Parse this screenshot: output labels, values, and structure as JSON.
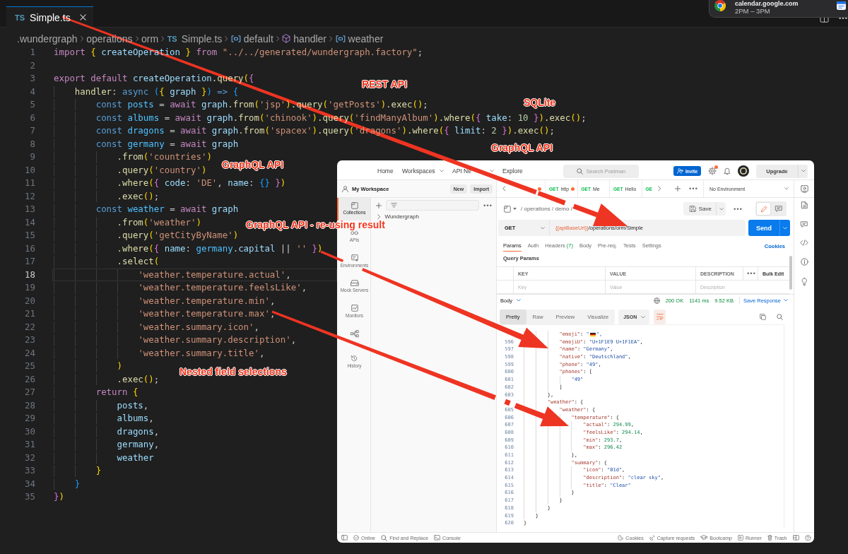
{
  "notification": {
    "title": "calendar.google.com",
    "subtitle": "2PM – 3PM"
  },
  "editor": {
    "tabs": [
      {
        "file_type": "TS",
        "label": "Simple.ts",
        "selected": true
      }
    ],
    "breadcrumb": [
      {
        "kind": "folder",
        "label": ".wundergraph"
      },
      {
        "kind": "folder",
        "label": "operations"
      },
      {
        "kind": "folder",
        "label": "orm"
      },
      {
        "kind": "file",
        "file_type": "TS",
        "label": "Simple.ts"
      },
      {
        "kind": "variable",
        "label": "default"
      },
      {
        "kind": "method",
        "label": "handler"
      },
      {
        "kind": "variable",
        "label": "weather"
      }
    ],
    "lines": [
      {
        "number": "1",
        "current": false,
        "tokens": [
          {
            "text": "import ",
            "kind": "kw"
          },
          {
            "text": "{",
            "kind": "br1"
          },
          {
            "text": " createOperation ",
            "kind": "var"
          },
          {
            "text": "}",
            "kind": "br1"
          },
          {
            "text": " from ",
            "kind": "kw"
          },
          {
            "text": "\"../../generated/wundergraph.factory\"",
            "kind": "str"
          },
          {
            "text": ";",
            "kind": "punct"
          }
        ]
      },
      {
        "number": "2",
        "current": false
      },
      {
        "number": "3",
        "current": false,
        "tokens": [
          {
            "text": "export default ",
            "kind": "kw"
          },
          {
            "text": "createOperation",
            "kind": "var"
          },
          {
            "text": ".query",
            "kind": "func"
          },
          {
            "text": "(",
            "kind": "br1"
          },
          {
            "text": "{",
            "kind": "br2"
          }
        ]
      },
      {
        "number": "4",
        "current": false,
        "tokens": [
          {
            "text": "    handler",
            "kind": "func"
          },
          {
            "text": ": ",
            "kind": "punct"
          },
          {
            "text": "async ",
            "kind": "storage"
          },
          {
            "text": "(",
            "kind": "br3"
          },
          {
            "text": "{",
            "kind": "br1"
          },
          {
            "text": " graph ",
            "kind": "var"
          },
          {
            "text": "}",
            "kind": "br1"
          },
          {
            "text": ")",
            "kind": "br3"
          },
          {
            "text": " => ",
            "kind": "storage"
          },
          {
            "text": "{",
            "kind": "br3"
          }
        ]
      },
      {
        "number": "5",
        "current": false,
        "tokens": [
          {
            "text": "        const ",
            "kind": "storage"
          },
          {
            "text": "posts",
            "kind": "const"
          },
          {
            "text": " = ",
            "kind": "punct"
          },
          {
            "text": "await ",
            "kind": "kw"
          },
          {
            "text": "graph",
            "kind": "var"
          },
          {
            "text": ".from",
            "kind": "func"
          },
          {
            "text": "(",
            "kind": "br1"
          },
          {
            "text": "'jsp'",
            "kind": "str"
          },
          {
            "text": ")",
            "kind": "br1"
          },
          {
            "text": ".query",
            "kind": "func"
          },
          {
            "text": "(",
            "kind": "br1"
          },
          {
            "text": "'getPosts'",
            "kind": "str"
          },
          {
            "text": ")",
            "kind": "br1"
          },
          {
            "text": ".exec",
            "kind": "func"
          },
          {
            "text": "()",
            "kind": "br1"
          },
          {
            "text": ";",
            "kind": "punct"
          }
        ]
      },
      {
        "number": "6",
        "current": false,
        "tokens": [
          {
            "text": "        const ",
            "kind": "storage"
          },
          {
            "text": "albums",
            "kind": "const"
          },
          {
            "text": " = ",
            "kind": "punct"
          },
          {
            "text": "await ",
            "kind": "kw"
          },
          {
            "text": "graph",
            "kind": "var"
          },
          {
            "text": ".from",
            "kind": "func"
          },
          {
            "text": "(",
            "kind": "br1"
          },
          {
            "text": "'chinook'",
            "kind": "str"
          },
          {
            "text": ")",
            "kind": "br1"
          },
          {
            "text": ".query",
            "kind": "func"
          },
          {
            "text": "(",
            "kind": "br1"
          },
          {
            "text": "'findManyAlbum'",
            "kind": "str"
          },
          {
            "text": ")",
            "kind": "br1"
          },
          {
            "text": ".where",
            "kind": "func"
          },
          {
            "text": "(",
            "kind": "br1"
          },
          {
            "text": "{",
            "kind": "br2"
          },
          {
            "text": " take",
            "kind": "var"
          },
          {
            "text": ": ",
            "kind": "punct"
          },
          {
            "text": "10",
            "kind": "num"
          },
          {
            "text": " }",
            "kind": "br2"
          },
          {
            "text": ")",
            "kind": "br1"
          },
          {
            "text": ".exec",
            "kind": "func"
          },
          {
            "text": "()",
            "kind": "br1"
          },
          {
            "text": ";",
            "kind": "punct"
          }
        ]
      },
      {
        "number": "7",
        "current": false,
        "tokens": [
          {
            "text": "        const ",
            "kind": "storage"
          },
          {
            "text": "dragons",
            "kind": "const"
          },
          {
            "text": " = ",
            "kind": "punct"
          },
          {
            "text": "await ",
            "kind": "kw"
          },
          {
            "text": "graph",
            "kind": "var"
          },
          {
            "text": ".from",
            "kind": "func"
          },
          {
            "text": "(",
            "kind": "br1"
          },
          {
            "text": "'spacex'",
            "kind": "str"
          },
          {
            "text": ")",
            "kind": "br1"
          },
          {
            "text": ".query",
            "kind": "func"
          },
          {
            "text": "(",
            "kind": "br1"
          },
          {
            "text": "'dragons'",
            "kind": "str"
          },
          {
            "text": ")",
            "kind": "br1"
          },
          {
            "text": ".where",
            "kind": "func"
          },
          {
            "text": "(",
            "kind": "br1"
          },
          {
            "text": "{",
            "kind": "br2"
          },
          {
            "text": " limit",
            "kind": "var"
          },
          {
            "text": ": ",
            "kind": "punct"
          },
          {
            "text": "2",
            "kind": "num"
          },
          {
            "text": " }",
            "kind": "br2"
          },
          {
            "text": ")",
            "kind": "br1"
          },
          {
            "text": ".exec",
            "kind": "func"
          },
          {
            "text": "()",
            "kind": "br1"
          },
          {
            "text": ";",
            "kind": "punct"
          }
        ]
      },
      {
        "number": "8",
        "current": false,
        "tokens": [
          {
            "text": "        const ",
            "kind": "storage"
          },
          {
            "text": "germany",
            "kind": "const"
          },
          {
            "text": " = ",
            "kind": "punct"
          },
          {
            "text": "await ",
            "kind": "kw"
          },
          {
            "text": "graph",
            "kind": "var"
          }
        ]
      },
      {
        "number": "9",
        "current": false,
        "tokens": [
          {
            "text": "            .from",
            "kind": "func"
          },
          {
            "text": "(",
            "kind": "br1"
          },
          {
            "text": "'countries'",
            "kind": "str"
          },
          {
            "text": ")",
            "kind": "br1"
          }
        ]
      },
      {
        "number": "10",
        "current": false,
        "tokens": [
          {
            "text": "            .query",
            "kind": "func"
          },
          {
            "text": "(",
            "kind": "br1"
          },
          {
            "text": "'country'",
            "kind": "str"
          },
          {
            "text": ")",
            "kind": "br1"
          }
        ]
      },
      {
        "number": "11",
        "current": false,
        "tokens": [
          {
            "text": "            .where",
            "kind": "func"
          },
          {
            "text": "(",
            "kind": "br1"
          },
          {
            "text": "{",
            "kind": "br2"
          },
          {
            "text": " code",
            "kind": "var"
          },
          {
            "text": ": ",
            "kind": "punct"
          },
          {
            "text": "'DE'",
            "kind": "str"
          },
          {
            "text": ", ",
            "kind": "punct"
          },
          {
            "text": "name",
            "kind": "var"
          },
          {
            "text": ": ",
            "kind": "punct"
          },
          {
            "text": "{}",
            "kind": "br3"
          },
          {
            "text": " }",
            "kind": "br2"
          },
          {
            "text": ")",
            "kind": "br1"
          }
        ]
      },
      {
        "number": "12",
        "current": false,
        "tokens": [
          {
            "text": "            .exec",
            "kind": "func"
          },
          {
            "text": "()",
            "kind": "br1"
          },
          {
            "text": ";",
            "kind": "punct"
          }
        ]
      },
      {
        "number": "13",
        "current": false,
        "tokens": [
          {
            "text": "        const ",
            "kind": "storage"
          },
          {
            "text": "weather",
            "kind": "const"
          },
          {
            "text": " = ",
            "kind": "punct"
          },
          {
            "text": "await ",
            "kind": "kw"
          },
          {
            "text": "graph",
            "kind": "var"
          }
        ]
      },
      {
        "number": "14",
        "current": false,
        "tokens": [
          {
            "text": "            .from",
            "kind": "func"
          },
          {
            "text": "(",
            "kind": "br1"
          },
          {
            "text": "'weather'",
            "kind": "str"
          },
          {
            "text": ")",
            "kind": "br1"
          }
        ]
      },
      {
        "number": "15",
        "current": false,
        "tokens": [
          {
            "text": "            .query",
            "kind": "func"
          },
          {
            "text": "(",
            "kind": "br1"
          },
          {
            "text": "'getCityByName'",
            "kind": "str"
          },
          {
            "text": ")",
            "kind": "br1"
          }
        ]
      },
      {
        "number": "16",
        "current": false,
        "tokens": [
          {
            "text": "            .where",
            "kind": "func"
          },
          {
            "text": "(",
            "kind": "br1"
          },
          {
            "text": "{",
            "kind": "br2"
          },
          {
            "text": " name",
            "kind": "var"
          },
          {
            "text": ": ",
            "kind": "punct"
          },
          {
            "text": "germany",
            "kind": "const"
          },
          {
            "text": ".",
            "kind": "punct"
          },
          {
            "text": "capital",
            "kind": "var"
          },
          {
            "text": " || ",
            "kind": "punct"
          },
          {
            "text": "''",
            "kind": "str"
          },
          {
            "text": " }",
            "kind": "br2"
          },
          {
            "text": ")",
            "kind": "br1"
          }
        ]
      },
      {
        "number": "17",
        "current": false,
        "tokens": [
          {
            "text": "            .select",
            "kind": "func"
          },
          {
            "text": "(",
            "kind": "br1"
          }
        ]
      },
      {
        "number": "18",
        "current": true,
        "tokens": [
          {
            "text": "                'weather.temperature.actual'",
            "kind": "str"
          },
          {
            "text": ",",
            "kind": "punct"
          }
        ]
      },
      {
        "number": "19",
        "current": false,
        "tokens": [
          {
            "text": "                'weather.temperature.feelsLike'",
            "kind": "str"
          },
          {
            "text": ",",
            "kind": "punct"
          }
        ]
      },
      {
        "number": "20",
        "current": false,
        "tokens": [
          {
            "text": "                'weather.temperature.min'",
            "kind": "str"
          },
          {
            "text": ",",
            "kind": "punct"
          }
        ]
      },
      {
        "number": "21",
        "current": false,
        "tokens": [
          {
            "text": "                'weather.temperature.max'",
            "kind": "str"
          },
          {
            "text": ",",
            "kind": "punct"
          }
        ]
      },
      {
        "number": "22",
        "current": false,
        "tokens": [
          {
            "text": "                'weather.summary.icon'",
            "kind": "str"
          },
          {
            "text": ",",
            "kind": "punct"
          }
        ]
      },
      {
        "number": "23",
        "current": false,
        "tokens": [
          {
            "text": "                'weather.summary.description'",
            "kind": "str"
          },
          {
            "text": ",",
            "kind": "punct"
          }
        ]
      },
      {
        "number": "24",
        "current": false,
        "tokens": [
          {
            "text": "                'weather.summary.title'",
            "kind": "str"
          },
          {
            "text": ",",
            "kind": "punct"
          }
        ]
      },
      {
        "number": "25",
        "current": false,
        "tokens": [
          {
            "text": "            )",
            "kind": "br1"
          }
        ]
      },
      {
        "number": "26",
        "current": false,
        "tokens": [
          {
            "text": "            .exec",
            "kind": "func"
          },
          {
            "text": "()",
            "kind": "br1"
          },
          {
            "text": ";",
            "kind": "punct"
          }
        ]
      },
      {
        "number": "27",
        "current": false,
        "tokens": [
          {
            "text": "        return ",
            "kind": "kw"
          },
          {
            "text": "{",
            "kind": "br1"
          }
        ]
      },
      {
        "number": "28",
        "current": false,
        "tokens": [
          {
            "text": "            posts",
            "kind": "var"
          },
          {
            "text": ",",
            "kind": "punct"
          }
        ]
      },
      {
        "number": "29",
        "current": false,
        "tokens": [
          {
            "text": "            albums",
            "kind": "var"
          },
          {
            "text": ",",
            "kind": "punct"
          }
        ]
      },
      {
        "number": "30",
        "current": false,
        "tokens": [
          {
            "text": "            dragons",
            "kind": "var"
          },
          {
            "text": ",",
            "kind": "punct"
          }
        ]
      },
      {
        "number": "31",
        "current": false,
        "tokens": [
          {
            "text": "            germany",
            "kind": "var"
          },
          {
            "text": ",",
            "kind": "punct"
          }
        ]
      },
      {
        "number": "32",
        "current": false,
        "tokens": [
          {
            "text": "            weather",
            "kind": "var"
          }
        ]
      },
      {
        "number": "33",
        "current": false,
        "tokens": [
          {
            "text": "        }",
            "kind": "br1"
          }
        ]
      },
      {
        "number": "34",
        "current": false,
        "tokens": [
          {
            "text": "    }",
            "kind": "br3"
          }
        ]
      },
      {
        "number": "35",
        "current": false,
        "tokens": [
          {
            "text": "}",
            "kind": "br2"
          },
          {
            "text": ")",
            "kind": "br1"
          }
        ]
      }
    ]
  },
  "postman": {
    "nav": [
      {
        "label": "Home",
        "dropdown": false
      },
      {
        "label": "Workspaces",
        "dropdown": true
      },
      {
        "label": "API Ne",
        "dropdown": true
      },
      {
        "label": "Explore",
        "dropdown": false
      }
    ],
    "search": {
      "placeholder": "Search Postman"
    },
    "invite_button": "Invite",
    "settings_badge": true,
    "upgrade_button": "Upgrade",
    "workspace": {
      "name": "My Workspace",
      "buttons": [
        "New",
        "Import"
      ]
    },
    "sidebar": [
      {
        "kind": "collections",
        "label": "Collections",
        "selected": true
      },
      {
        "kind": "apis",
        "label": "APIs",
        "selected": false
      },
      {
        "kind": "environments",
        "label": "Environments",
        "selected": false
      },
      {
        "kind": "mock_servers",
        "label": "Mock Servers",
        "selected": false
      },
      {
        "kind": "monitors",
        "label": "Monitors",
        "selected": false
      },
      {
        "kind": "flows",
        "selected": false
      },
      {
        "kind": "history",
        "label": "History",
        "selected": false
      }
    ],
    "collections": [
      {
        "label": "Wundergraph",
        "expanded": false
      }
    ],
    "request_tabs": [
      {
        "unsaved": true
      },
      {
        "method": "GET",
        "label": "http",
        "unsaved": true
      },
      {
        "method": "GET",
        "label": "Me",
        "unsaved": false
      },
      {
        "method": "GET",
        "label": "Hello",
        "unsaved": false
      },
      {
        "method": "GE",
        "unsaved": false
      }
    ],
    "environment": "No Environment",
    "breadcrumb": "/ operations / demo /",
    "save_button": "Save",
    "mode_toggle": [
      {
        "kind": "edit",
        "selected": true
      },
      {
        "kind": "comments",
        "selected": false
      }
    ],
    "method": "GET",
    "url": {
      "variable": "{{apiBaseUrl}}",
      "path": "/operations/orm/Simple"
    },
    "send_button": "Send",
    "request_sections": [
      {
        "label": "Params",
        "selected": true
      },
      {
        "label": "Auth",
        "selected": false
      },
      {
        "label": "Headers",
        "count": "(7)",
        "selected": false
      },
      {
        "label": "Body",
        "selected": false
      },
      {
        "label": "Pre-req.",
        "selected": false
      },
      {
        "label": "Tests",
        "selected": false
      },
      {
        "label": "Settings",
        "selected": false
      }
    ],
    "cookies_link": "Cookies",
    "query_params": {
      "title": "Query Params",
      "columns": [
        {
          "label": "KEY",
          "placeholder": "Key"
        },
        {
          "label": "VALUE",
          "placeholder": "Value"
        },
        {
          "label": "DESCRIPTION",
          "placeholder": "Description"
        }
      ],
      "bulk_edit": "Bulk Edit"
    },
    "response": {
      "section": "Body",
      "status": "200 OK",
      "time": "1141 ms",
      "size": "9.52 KB",
      "save_response": "Save Response",
      "views": [
        {
          "label": "Pretty",
          "selected": true
        },
        {
          "label": "Raw",
          "selected": false
        },
        {
          "label": "Preview",
          "selected": false
        },
        {
          "label": "Visualize",
          "selected": false
        }
      ],
      "format": "JSON",
      "wrap_lines": true,
      "lines": [
        {
          "kind": "flag",
          "text": "            \"emoji\": \"",
          "text_after": "\","
        },
        {
          "kind": "text",
          "number": "596",
          "text": "            \"emojiU\": \"U+1F1E9 U+1F1EA\","
        },
        {
          "kind": "text",
          "number": "597",
          "text": "            \"name\": \"Germany\","
        },
        {
          "kind": "text",
          "number": "598",
          "text": "            \"native\": \"Deutschland\","
        },
        {
          "kind": "text",
          "number": "599",
          "text": "            \"phone\": \"49\","
        },
        {
          "kind": "text",
          "number": "600",
          "text": "            \"phones\": ["
        },
        {
          "kind": "text",
          "number": "601",
          "text": "                \"49\""
        },
        {
          "kind": "text",
          "number": "602",
          "text": "            ]"
        },
        {
          "kind": "text",
          "number": "603",
          "text": "        },"
        },
        {
          "kind": "text",
          "text": "        \"weather\": {"
        },
        {
          "kind": "text",
          "number": "605",
          "text": "            \"weather\": {"
        },
        {
          "kind": "text",
          "number": "606",
          "text": "                \"temperature\": {"
        },
        {
          "kind": "text",
          "number": "607",
          "text": "                    \"actual\": 294.99,"
        },
        {
          "kind": "text",
          "number": "608",
          "text": "                    \"feelsLike\": 294.14,"
        },
        {
          "kind": "text",
          "number": "609",
          "text": "                    \"min\": 293.7,"
        },
        {
          "kind": "text",
          "number": "610",
          "text": "                    \"max\": 296.42"
        },
        {
          "kind": "text",
          "number": "611",
          "text": "                },"
        },
        {
          "kind": "text",
          "number": "612",
          "text": "                \"summary\": {"
        },
        {
          "kind": "text",
          "number": "613",
          "text": "                    \"icon\": \"01d\","
        },
        {
          "kind": "text",
          "number": "614",
          "text": "                    \"description\": \"clear sky\","
        },
        {
          "kind": "text",
          "number": "615",
          "text": "                    \"title\": \"Clear\""
        },
        {
          "kind": "text",
          "number": "616",
          "text": "                }"
        },
        {
          "kind": "text",
          "number": "617",
          "text": "            }"
        },
        {
          "kind": "text",
          "number": "618",
          "text": "        }"
        },
        {
          "kind": "text",
          "number": "619",
          "text": "    }"
        },
        {
          "kind": "text",
          "number": "620",
          "text": "}"
        }
      ]
    },
    "status_bar": {
      "left": [
        {
          "kind": "online",
          "label": "Online"
        },
        {
          "kind": "find",
          "label": "Find and Replace"
        },
        {
          "kind": "console",
          "label": "Console"
        }
      ],
      "right": [
        {
          "kind": "cookies",
          "label": "Cookies"
        },
        {
          "kind": "capture",
          "label": "Capture requests"
        },
        {
          "kind": "bootcamp",
          "label": "Bootcamp"
        },
        {
          "kind": "runner",
          "label": "Runner"
        },
        {
          "kind": "trash",
          "label": "Trash"
        }
      ]
    }
  },
  "annotations": [
    {
      "text": "REST API"
    },
    {
      "text": "SQLite"
    },
    {
      "text": "GraphQL API"
    },
    {
      "text": "GraphQL API"
    },
    {
      "text": "GraphQL API - re-using result"
    },
    {
      "text": "Nested field selections"
    }
  ]
}
